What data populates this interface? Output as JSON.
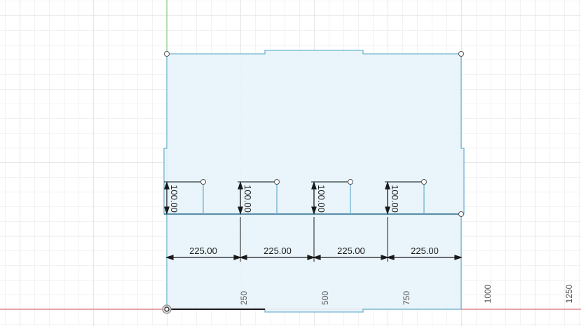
{
  "sketch": {
    "horizontal_dimensions": [
      "225.00",
      "225.00",
      "225.00",
      "225.00"
    ],
    "vertical_dimensions": [
      "100.00",
      "100.00",
      "100.00",
      "100.00"
    ],
    "axis_ticks": [
      "250",
      "500",
      "750",
      "1000",
      "1250"
    ]
  },
  "colors": {
    "profile_fill": "#e8f4fb",
    "profile_stroke": "#6fb3cf",
    "x_axis": "#e06060",
    "y_axis": "#6cc46c",
    "dimension_line": "#1a1a1a"
  }
}
